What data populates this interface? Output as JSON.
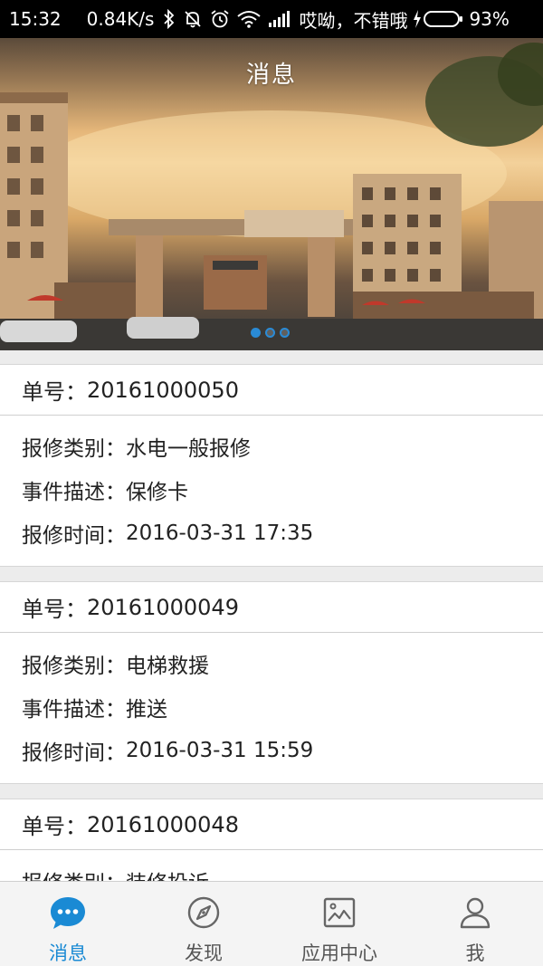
{
  "status_bar": {
    "time": "15:32",
    "speed": "0.84K/s",
    "carrier": "哎呦，不错哦",
    "battery_percent": "93%",
    "battery_level": 0.93,
    "icons": [
      "bluetooth-icon",
      "mute-icon",
      "alarm-icon",
      "wifi-icon",
      "signal-icon",
      "charging-icon"
    ]
  },
  "header": {
    "title": "消息"
  },
  "banner": {
    "slide_count": 3,
    "active_slide": 1
  },
  "messages": [
    {
      "order_label": "单号：",
      "order_no": "20161000050",
      "fields": [
        {
          "label": "报修类别：",
          "value": "水电一般报修"
        },
        {
          "label": "事件描述：",
          "value": "保修卡"
        },
        {
          "label": "报修时间：",
          "value": "2016-03-31 17:35"
        }
      ]
    },
    {
      "order_label": "单号：",
      "order_no": "20161000049",
      "fields": [
        {
          "label": "报修类别：",
          "value": "电梯救援"
        },
        {
          "label": "事件描述：",
          "value": "推送"
        },
        {
          "label": "报修时间：",
          "value": "2016-03-31 15:59"
        }
      ]
    },
    {
      "order_label": "单号：",
      "order_no": "20161000048",
      "fields": [
        {
          "label": "报修类别：",
          "value": "装修投诉"
        }
      ]
    }
  ],
  "tabs": [
    {
      "label": "消息",
      "icon": "chat-bubble-icon",
      "active": true
    },
    {
      "label": "发现",
      "icon": "compass-icon",
      "active": false
    },
    {
      "label": "应用中心",
      "icon": "picture-icon",
      "active": false
    },
    {
      "label": "我",
      "icon": "person-icon",
      "active": false
    }
  ],
  "colors": {
    "accent": "#1a8ad4",
    "inactive_tab": "#555555",
    "background": "#ececec",
    "battery": "#2ecc40"
  }
}
